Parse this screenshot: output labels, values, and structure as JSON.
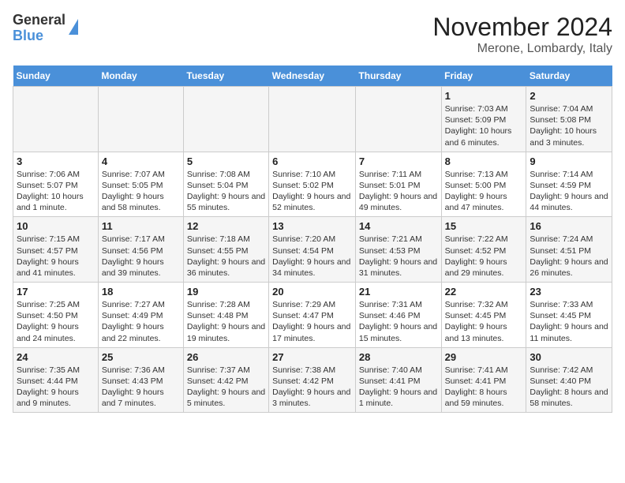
{
  "logo": {
    "line1": "General",
    "line2": "Blue"
  },
  "title": "November 2024",
  "subtitle": "Merone, Lombardy, Italy",
  "days_of_week": [
    "Sunday",
    "Monday",
    "Tuesday",
    "Wednesday",
    "Thursday",
    "Friday",
    "Saturday"
  ],
  "weeks": [
    [
      {
        "day": "",
        "info": ""
      },
      {
        "day": "",
        "info": ""
      },
      {
        "day": "",
        "info": ""
      },
      {
        "day": "",
        "info": ""
      },
      {
        "day": "",
        "info": ""
      },
      {
        "day": "1",
        "info": "Sunrise: 7:03 AM\nSunset: 5:09 PM\nDaylight: 10 hours and 6 minutes."
      },
      {
        "day": "2",
        "info": "Sunrise: 7:04 AM\nSunset: 5:08 PM\nDaylight: 10 hours and 3 minutes."
      }
    ],
    [
      {
        "day": "3",
        "info": "Sunrise: 7:06 AM\nSunset: 5:07 PM\nDaylight: 10 hours and 1 minute."
      },
      {
        "day": "4",
        "info": "Sunrise: 7:07 AM\nSunset: 5:05 PM\nDaylight: 9 hours and 58 minutes."
      },
      {
        "day": "5",
        "info": "Sunrise: 7:08 AM\nSunset: 5:04 PM\nDaylight: 9 hours and 55 minutes."
      },
      {
        "day": "6",
        "info": "Sunrise: 7:10 AM\nSunset: 5:02 PM\nDaylight: 9 hours and 52 minutes."
      },
      {
        "day": "7",
        "info": "Sunrise: 7:11 AM\nSunset: 5:01 PM\nDaylight: 9 hours and 49 minutes."
      },
      {
        "day": "8",
        "info": "Sunrise: 7:13 AM\nSunset: 5:00 PM\nDaylight: 9 hours and 47 minutes."
      },
      {
        "day": "9",
        "info": "Sunrise: 7:14 AM\nSunset: 4:59 PM\nDaylight: 9 hours and 44 minutes."
      }
    ],
    [
      {
        "day": "10",
        "info": "Sunrise: 7:15 AM\nSunset: 4:57 PM\nDaylight: 9 hours and 41 minutes."
      },
      {
        "day": "11",
        "info": "Sunrise: 7:17 AM\nSunset: 4:56 PM\nDaylight: 9 hours and 39 minutes."
      },
      {
        "day": "12",
        "info": "Sunrise: 7:18 AM\nSunset: 4:55 PM\nDaylight: 9 hours and 36 minutes."
      },
      {
        "day": "13",
        "info": "Sunrise: 7:20 AM\nSunset: 4:54 PM\nDaylight: 9 hours and 34 minutes."
      },
      {
        "day": "14",
        "info": "Sunrise: 7:21 AM\nSunset: 4:53 PM\nDaylight: 9 hours and 31 minutes."
      },
      {
        "day": "15",
        "info": "Sunrise: 7:22 AM\nSunset: 4:52 PM\nDaylight: 9 hours and 29 minutes."
      },
      {
        "day": "16",
        "info": "Sunrise: 7:24 AM\nSunset: 4:51 PM\nDaylight: 9 hours and 26 minutes."
      }
    ],
    [
      {
        "day": "17",
        "info": "Sunrise: 7:25 AM\nSunset: 4:50 PM\nDaylight: 9 hours and 24 minutes."
      },
      {
        "day": "18",
        "info": "Sunrise: 7:27 AM\nSunset: 4:49 PM\nDaylight: 9 hours and 22 minutes."
      },
      {
        "day": "19",
        "info": "Sunrise: 7:28 AM\nSunset: 4:48 PM\nDaylight: 9 hours and 19 minutes."
      },
      {
        "day": "20",
        "info": "Sunrise: 7:29 AM\nSunset: 4:47 PM\nDaylight: 9 hours and 17 minutes."
      },
      {
        "day": "21",
        "info": "Sunrise: 7:31 AM\nSunset: 4:46 PM\nDaylight: 9 hours and 15 minutes."
      },
      {
        "day": "22",
        "info": "Sunrise: 7:32 AM\nSunset: 4:45 PM\nDaylight: 9 hours and 13 minutes."
      },
      {
        "day": "23",
        "info": "Sunrise: 7:33 AM\nSunset: 4:45 PM\nDaylight: 9 hours and 11 minutes."
      }
    ],
    [
      {
        "day": "24",
        "info": "Sunrise: 7:35 AM\nSunset: 4:44 PM\nDaylight: 9 hours and 9 minutes."
      },
      {
        "day": "25",
        "info": "Sunrise: 7:36 AM\nSunset: 4:43 PM\nDaylight: 9 hours and 7 minutes."
      },
      {
        "day": "26",
        "info": "Sunrise: 7:37 AM\nSunset: 4:42 PM\nDaylight: 9 hours and 5 minutes."
      },
      {
        "day": "27",
        "info": "Sunrise: 7:38 AM\nSunset: 4:42 PM\nDaylight: 9 hours and 3 minutes."
      },
      {
        "day": "28",
        "info": "Sunrise: 7:40 AM\nSunset: 4:41 PM\nDaylight: 9 hours and 1 minute."
      },
      {
        "day": "29",
        "info": "Sunrise: 7:41 AM\nSunset: 4:41 PM\nDaylight: 8 hours and 59 minutes."
      },
      {
        "day": "30",
        "info": "Sunrise: 7:42 AM\nSunset: 4:40 PM\nDaylight: 8 hours and 58 minutes."
      }
    ]
  ]
}
